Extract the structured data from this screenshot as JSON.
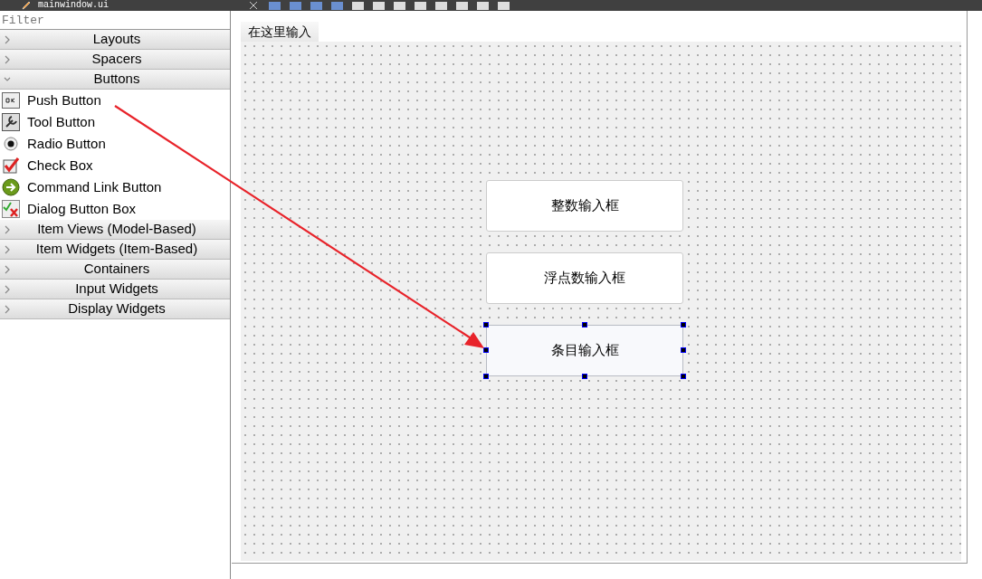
{
  "window": {
    "title": "mainwindow.ui"
  },
  "widget_box": {
    "filter": {
      "placeholder": "Filter"
    },
    "categories": [
      {
        "label": "Layouts",
        "expanded": false
      },
      {
        "label": "Spacers",
        "expanded": false
      },
      {
        "label": "Buttons",
        "expanded": true,
        "children": [
          {
            "label": "Push Button",
            "kind": "push"
          },
          {
            "label": "Tool Button",
            "kind": "tool"
          },
          {
            "label": "Radio Button",
            "kind": "radio"
          },
          {
            "label": "Check Box",
            "kind": "check"
          },
          {
            "label": "Command Link Button",
            "kind": "command"
          },
          {
            "label": "Dialog Button Box",
            "kind": "dialog"
          }
        ]
      },
      {
        "label": "Item Views (Model-Based)",
        "expanded": false
      },
      {
        "label": "Item Widgets (Item-Based)",
        "expanded": false
      },
      {
        "label": "Containers",
        "expanded": false
      },
      {
        "label": "Input Widgets",
        "expanded": false
      },
      {
        "label": "Display Widgets",
        "expanded": false
      }
    ]
  },
  "form": {
    "menu_item": "在这里输入",
    "widgets": [
      {
        "text": "整数输入框",
        "selected": false
      },
      {
        "text": "浮点数输入框",
        "selected": false
      },
      {
        "text": "条目输入框",
        "selected": true
      }
    ]
  }
}
